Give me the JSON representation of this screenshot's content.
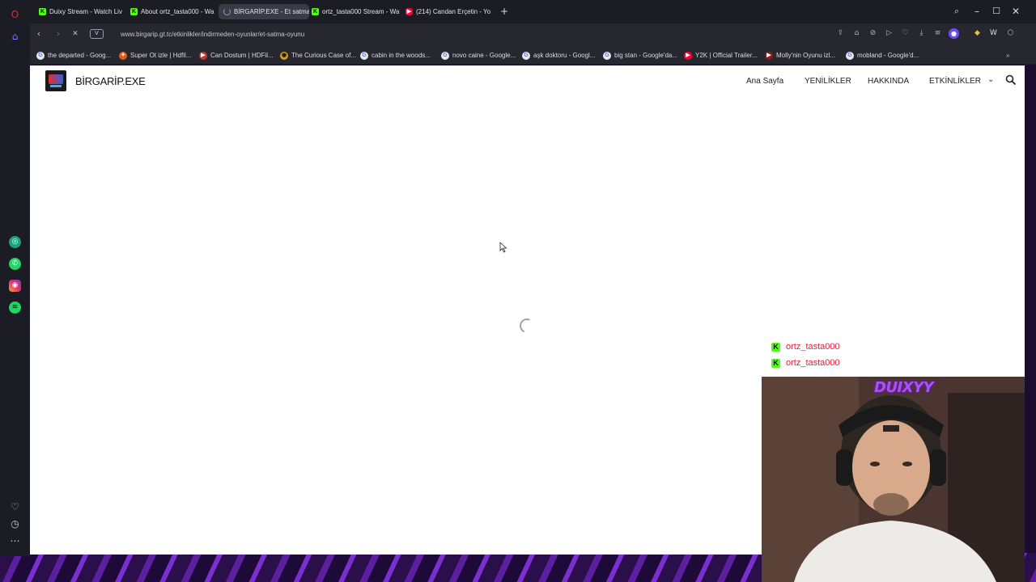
{
  "tabs": [
    {
      "label": "Duixy Stream - Watch Liv",
      "favicon": "kick-icon",
      "active": false
    },
    {
      "label": "About ortz_tasta000 - Wa",
      "favicon": "kick-icon",
      "active": false
    },
    {
      "label": "BİRGARİP.EXE - Et satma",
      "favicon": "loading-icon",
      "active": true
    },
    {
      "label": "ortz_tasta000 Stream - Wa",
      "favicon": "kick-icon",
      "active": false
    },
    {
      "label": "(214) Candan Erçetin - Yo",
      "favicon": "youtube-icon",
      "active": false
    }
  ],
  "address_bar": {
    "vpn_label": "V",
    "url": "www.birgarip.gt.tc/etkinlikler/indirmeden-oyunlar/et-satma-oyunu"
  },
  "bookmarks": [
    {
      "label": "the departed - Goog...",
      "icon": "google-icon"
    },
    {
      "label": "Super Ot izle | Hdfil...",
      "icon": "film-icon"
    },
    {
      "label": "Can Dostum | HDFil...",
      "icon": "film-icon"
    },
    {
      "label": "The Curious Case of...",
      "icon": "film-icon"
    },
    {
      "label": "cabin in the woods...",
      "icon": "google-icon"
    },
    {
      "label": "novo caine - Google...",
      "icon": "google-icon"
    },
    {
      "label": "aşk doktoru - Googl...",
      "icon": "google-icon"
    },
    {
      "label": "big stan - Google'da...",
      "icon": "google-icon"
    },
    {
      "label": "Y2K | Official Trailer...",
      "icon": "youtube-icon"
    },
    {
      "label": "Molly'nin Oyunu izl...",
      "icon": "film-icon"
    },
    {
      "label": "mobland - Google'd...",
      "icon": "google-icon"
    }
  ],
  "site": {
    "title": "BİRGARİP.EXE",
    "nav": [
      "Ana Sayfa",
      "YENİLİKLER",
      "HAKKINDA",
      "ETKİNLİKLER"
    ]
  },
  "chat": [
    {
      "username": "ortz_tasta000"
    },
    {
      "username": "ortz_tasta000"
    }
  ],
  "webcam": {
    "overlay_text": "DUIXYY"
  }
}
